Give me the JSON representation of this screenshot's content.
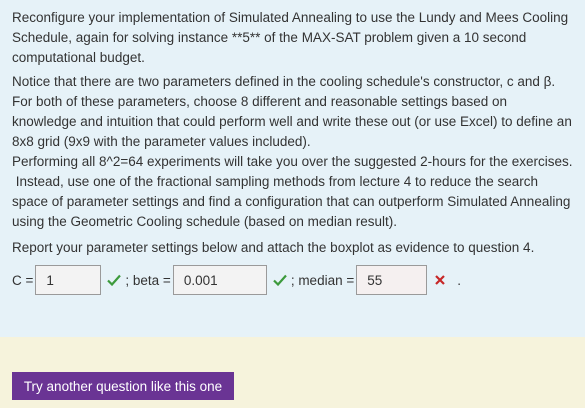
{
  "question": {
    "paragraph1": "Reconfigure your implementation of Simulated Annealing to use the Lundy and Mees Cooling Schedule, again for solving instance **5** of the MAX-SAT problem given a 10 second computational budget.",
    "paragraph2": "Notice that there are two parameters defined in the cooling schedule's constructor, c and β. For both of these parameters, choose 8 different and reasonable settings based on knowledge and intuition that could perform well and write these out (or use Excel) to define an 8x8 grid (9x9 with the parameter values included).",
    "paragraph3": "Performing all 8^2=64 experiments will take you over the suggested 2-hours for the exercises.",
    "paragraph4": " Instead, use one of the fractional sampling methods from lecture 4 to reduce the search space of parameter settings and find a configuration that can outperform Simulated Annealing using the Geometric Cooling schedule (based on median result).",
    "paragraph5": "Report your parameter settings below and attach the boxplot as evidence to question 4."
  },
  "answers": {
    "c_label": "C =",
    "c_value": "1",
    "beta_label": "; beta =",
    "beta_value": "0.001",
    "median_label": "; median =",
    "median_value": "55",
    "end": "."
  },
  "colors": {
    "correct": "#3c9a3c",
    "wrong": "#c62828",
    "button": "#6a3494"
  },
  "icons": {
    "correct": "check-icon",
    "wrong": "cross-icon"
  },
  "footer": {
    "button_label": "Try another question like this one"
  }
}
